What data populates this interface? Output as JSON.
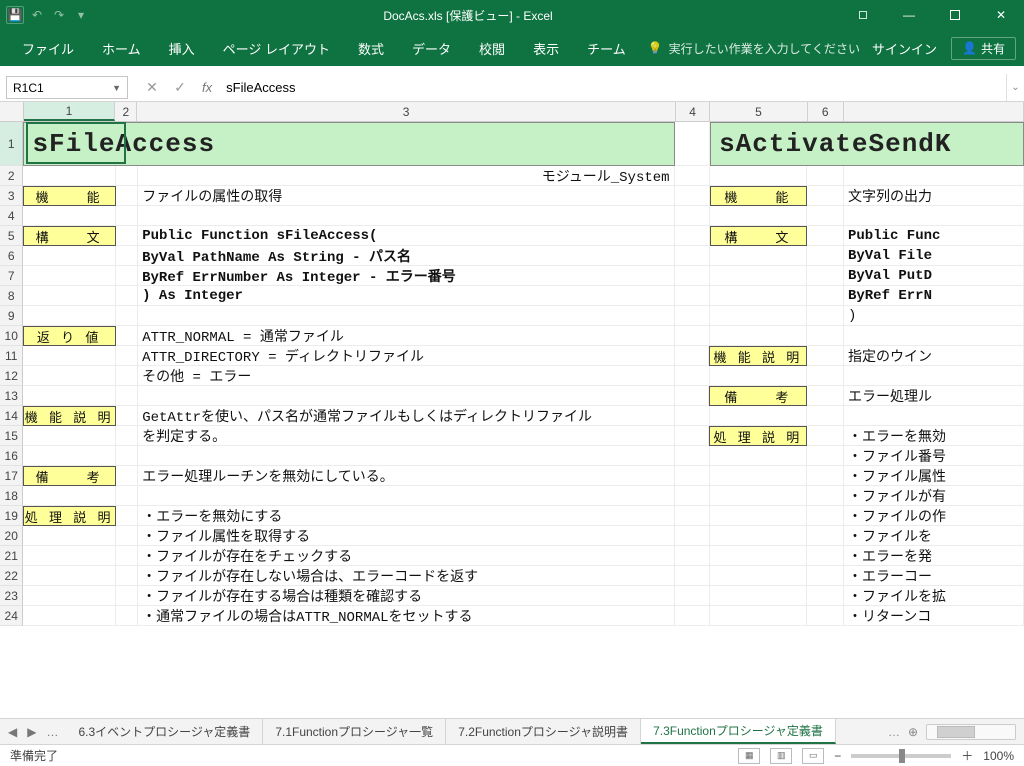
{
  "title": "DocAcs.xls  [保護ビュー] - Excel",
  "qat": {
    "save": "💾",
    "undo": "↶",
    "redo": "↷"
  },
  "ribbon": {
    "tabs": [
      "ファイル",
      "ホーム",
      "挿入",
      "ページ レイアウト",
      "数式",
      "データ",
      "校閲",
      "表示",
      "チーム"
    ],
    "tell": "実行したい作業を入力してください",
    "signin": "サインイン",
    "share": "共有"
  },
  "namebox": "R1C1",
  "formula": "sFileAccess",
  "columns": {
    "c1": 102,
    "c2": 24,
    "c3": 598,
    "c4": 38,
    "c5": 108,
    "c6": 40,
    "rest": 200
  },
  "col_labels": [
    "1",
    "2",
    "3",
    "4",
    "5",
    "6"
  ],
  "sheet": {
    "r1": {
      "left_title": "sFileAccess",
      "right_title": "sActivateSendK"
    },
    "r2_c3": "モジュール_System",
    "r3": {
      "l1": "機　　能",
      "c3": "ファイルの属性の取得",
      "r1": "機　　能",
      "r_c3": "文字列の出力"
    },
    "r5": {
      "l1": "構　　文",
      "c3": "Public Function sFileAccess(",
      "r1": "構　　文",
      "r_c3": "Public Func"
    },
    "r6": {
      "c3": "  ByVal PathName   As String  - パス名",
      "r_c3": "  ByVal File"
    },
    "r7": {
      "c3": "  ByRef ErrNumber  As Integer - エラー番号",
      "r_c3": "  ByVal PutD"
    },
    "r8": {
      "c3": ") As Integer",
      "r_c3": "  ByRef ErrN"
    },
    "r9": {
      "r_c3": ")"
    },
    "r10": {
      "l1": "返 り 値",
      "c3": "ATTR_NORMAL    = 通常ファイル"
    },
    "r11": {
      "c3": "ATTR_DIRECTORY = ディレクトリファイル",
      "r1": "機 能 説 明",
      "r_c3": "指定のウイン"
    },
    "r12": {
      "c3": "その他         = エラー"
    },
    "r13": {
      "r1": "備　　考",
      "r_c3": "エラー処理ル"
    },
    "r14": {
      "l1": "機 能 説 明",
      "c3": "GetAttrを使い、パス名が通常ファイルもしくはディレクトリファイル"
    },
    "r15": {
      "c3": "を判定する。",
      "r1": "処 理 説 明",
      "r_c3": "・エラーを無効"
    },
    "r16": {
      "r_c3": "・ファイル番号"
    },
    "r17": {
      "l1": "備　　考",
      "c3": "エラー処理ルーチンを無効にしている。",
      "r_c3": "・ファイル属性"
    },
    "r18": {
      "r_c3": "・ファイルが有"
    },
    "r19": {
      "l1": "処 理 説 明",
      "c3": "・エラーを無効にする",
      "r_c3": "・ファイルの作"
    },
    "r20": {
      "c3": "・ファイル属性を取得する",
      "r_c3": "  ・ファイルを"
    },
    "r21": {
      "c3": "・ファイルが存在をチェックする",
      "r_c3": "  ・エラーを発"
    },
    "r22": {
      "c3": "  ・ファイルが存在しない場合は、エラーコードを返す",
      "r_c3": "  ・エラーコー"
    },
    "r23": {
      "c3": "・ファイルが存在する場合は種類を確認する",
      "r_c3": "・ファイルを拡"
    },
    "r24": {
      "c3": "  ・通常ファイルの場合はATTR_NORMALをセットする",
      "r_c3": "・リターンコ"
    }
  },
  "tabs": {
    "list": [
      "6.3イベントプロシージャ定義書",
      "7.1Functionプロシージャ一覧",
      "7.2Functionプロシージャ説明書",
      "7.3Functionプロシージャ定義書"
    ],
    "active": 3
  },
  "status": {
    "ready": "準備完了",
    "zoom": "100%"
  }
}
